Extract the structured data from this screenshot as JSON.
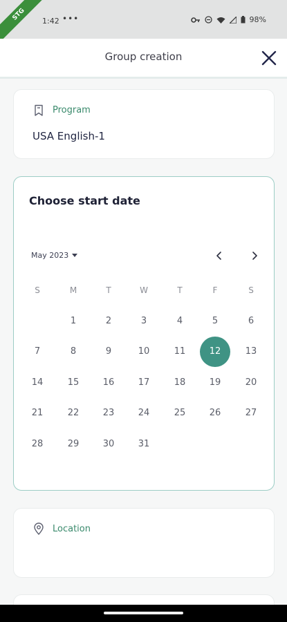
{
  "status_bar": {
    "time": "1:42",
    "dots": "•••",
    "battery": "98%",
    "ribbon": "STG"
  },
  "header": {
    "title": "Group creation"
  },
  "program": {
    "label": "Program",
    "value": "USA English-1"
  },
  "calendar": {
    "title": "Choose start date",
    "month_label": "May 2023",
    "weekdays": [
      "S",
      "M",
      "T",
      "W",
      "T",
      "F",
      "S"
    ],
    "selected_day": "12",
    "weeks": [
      [
        "",
        "1",
        "2",
        "3",
        "4",
        "5",
        "6"
      ],
      [
        "7",
        "8",
        "9",
        "10",
        "11",
        "12",
        "13"
      ],
      [
        "14",
        "15",
        "16",
        "17",
        "18",
        "19",
        "20"
      ],
      [
        "21",
        "22",
        "23",
        "24",
        "25",
        "26",
        "27"
      ],
      [
        "28",
        "29",
        "30",
        "31",
        "",
        "",
        ""
      ]
    ]
  },
  "location": {
    "label": "Location"
  },
  "colors": {
    "accent": "#3f9384",
    "label_green": "#3a8a6c",
    "card_border_active": "#9ccdc5"
  },
  "icons": {
    "program": "bookmark-icon",
    "location": "map-pin-icon",
    "close": "close-icon"
  }
}
